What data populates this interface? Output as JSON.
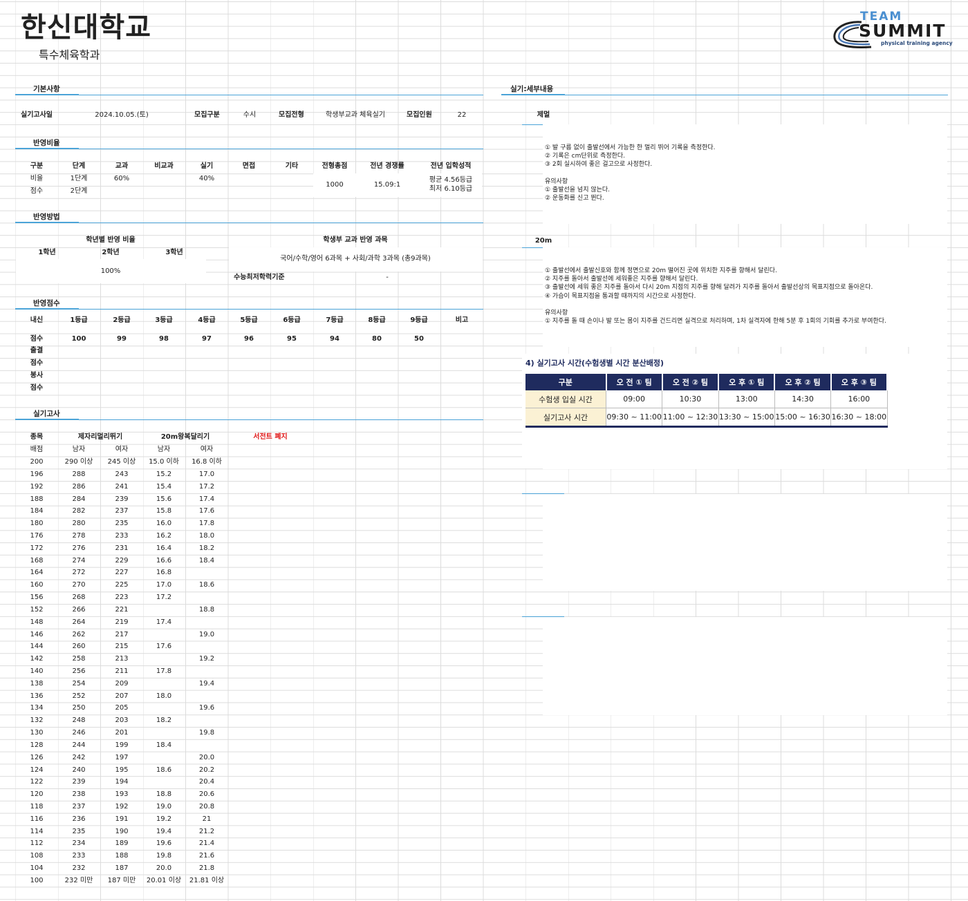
{
  "header": {
    "university": "한신대학교",
    "department": "특수체육학과",
    "logo": {
      "team": "TEAM",
      "summit": "SUMMIT",
      "tagline": "physical training agency"
    }
  },
  "basic": {
    "section_label": "기본사항",
    "exam_date_label": "실기고사일",
    "exam_date": "2024.10.05.(토)",
    "category_label": "모집구분",
    "category": "수시",
    "track_label": "모집전형",
    "track": "학생부교과 체육실기",
    "quota_label": "모집인원",
    "quota": "22"
  },
  "ratio": {
    "section_label": "반영비율",
    "headers": [
      "구분",
      "단계",
      "교과",
      "비교과",
      "실기",
      "면접",
      "기타",
      "전형총점",
      "전년 경쟁률",
      "전년 입학성적"
    ],
    "row1": {
      "label": "비율",
      "stage": "1단계",
      "subject": "60%",
      "practical": "40%"
    },
    "row2": {
      "label": "점수",
      "stage": "2단계"
    },
    "total": "1000",
    "competition": "15.09:1",
    "grade_avg": "평균 4.56등급",
    "grade_min": "최저 6.10등급"
  },
  "method": {
    "section_label": "반영방법",
    "year_ratio_label": "학년별 반영 비율",
    "years": [
      "1학년",
      "2학년",
      "3학년"
    ],
    "year_value": "100%",
    "subjects_label": "학생부 교과 반영 과목",
    "subjects": "국어/수학/영어 6과목 + 사회/과학 3과목 (총9과목)",
    "csat_label": "수능최저학력기준",
    "csat_value": "-"
  },
  "score": {
    "section_label": "반영점수",
    "headers": [
      "내신",
      "1등급",
      "2등급",
      "3등급",
      "4등급",
      "5등급",
      "6등급",
      "7등급",
      "8등급",
      "9등급",
      "비고"
    ],
    "score_label": "점수",
    "values": [
      "100",
      "99",
      "98",
      "97",
      "96",
      "95",
      "94",
      "80",
      "50"
    ],
    "rows": [
      "출결",
      "점수",
      "봉사",
      "점수"
    ]
  },
  "practical": {
    "section_label": "실기고사",
    "event_label": "종목",
    "event1": "제자리멀리뛰기",
    "event2": "20m왕복달리기",
    "note": "서전트 폐지",
    "points_label": "배점",
    "male": "남자",
    "female": "여자",
    "rows": [
      [
        "200",
        "290 이상",
        "245 이상",
        "15.0 이하",
        "16.8 이하"
      ],
      [
        "196",
        "288",
        "243",
        "15.2",
        "17.0"
      ],
      [
        "192",
        "286",
        "241",
        "15.4",
        "17.2"
      ],
      [
        "188",
        "284",
        "239",
        "15.6",
        "17.4"
      ],
      [
        "184",
        "282",
        "237",
        "15.8",
        "17.6"
      ],
      [
        "180",
        "280",
        "235",
        "16.0",
        "17.8"
      ],
      [
        "176",
        "278",
        "233",
        "16.2",
        "18.0"
      ],
      [
        "172",
        "276",
        "231",
        "16.4",
        "18.2"
      ],
      [
        "168",
        "274",
        "229",
        "16.6",
        "18.4"
      ],
      [
        "164",
        "272",
        "227",
        "16.8",
        ""
      ],
      [
        "160",
        "270",
        "225",
        "17.0",
        "18.6"
      ],
      [
        "156",
        "268",
        "223",
        "17.2",
        ""
      ],
      [
        "152",
        "266",
        "221",
        "",
        "18.8"
      ],
      [
        "148",
        "264",
        "219",
        "17.4",
        ""
      ],
      [
        "146",
        "262",
        "217",
        "",
        "19.0"
      ],
      [
        "144",
        "260",
        "215",
        "17.6",
        ""
      ],
      [
        "142",
        "258",
        "213",
        "",
        "19.2"
      ],
      [
        "140",
        "256",
        "211",
        "17.8",
        ""
      ],
      [
        "138",
        "254",
        "209",
        "",
        "19.4"
      ],
      [
        "136",
        "252",
        "207",
        "18.0",
        ""
      ],
      [
        "134",
        "250",
        "205",
        "",
        "19.6"
      ],
      [
        "132",
        "248",
        "203",
        "18.2",
        ""
      ],
      [
        "130",
        "246",
        "201",
        "",
        "19.8"
      ],
      [
        "128",
        "244",
        "199",
        "18.4",
        ""
      ],
      [
        "126",
        "242",
        "197",
        "",
        "20.0"
      ],
      [
        "124",
        "240",
        "195",
        "18.6",
        "20.2"
      ],
      [
        "122",
        "239",
        "194",
        "",
        "20.4"
      ],
      [
        "120",
        "238",
        "193",
        "18.8",
        "20.6"
      ],
      [
        "118",
        "237",
        "192",
        "19.0",
        "20.8"
      ],
      [
        "116",
        "236",
        "191",
        "19.2",
        "21"
      ],
      [
        "114",
        "235",
        "190",
        "19.4",
        "21.2"
      ],
      [
        "112",
        "234",
        "189",
        "19.6",
        "21.4"
      ],
      [
        "108",
        "233",
        "188",
        "19.8",
        "21.6"
      ],
      [
        "104",
        "232",
        "187",
        "20.0",
        "21.8"
      ],
      [
        "100",
        "232 미만",
        "187 미만",
        "20.01 이상",
        "21.81 이상"
      ]
    ]
  },
  "detail": {
    "section_label": "실기:세부내용",
    "jump": {
      "title": "제멀",
      "lines": [
        "① 발 구름 없이 출발선에서 가능한 한 멀리 뛰어 기록을 측정한다.",
        "② 기록은 cm단위로 측정한다.",
        "③ 2회 실시하여 좋은 걸고으로 사정한다.",
        "",
        "유의사항",
        "① 출발선을 넘지 않는다.",
        "② 운동화를 신고 뛴다."
      ]
    },
    "run": {
      "title": "20m",
      "lines": [
        "① 출발선에서 출발신호와 함께 정면으로 20m 떨어진 곳에 위치한 지주를 향해서 달린다.",
        "② 지주를 돌아서 출발선에 세워좋은 지주를 향해서 달린다.",
        "③ 출발선에 세워 좋은 지주를 돌아서 다시 20m 지점의 지주를 향해 달려가 지주를 돌아서 출발선상의 목표지점으로 돌아온다.",
        "④ 가슴이 목표지점을 통과할 때까지의 시간으로 사정한다.",
        "",
        "유의사항",
        "① 지주를 돌 때 손이나 발 또는 몸이 지주를 건드리면 실격으로 처리하며, 1차 실격자에 한해 5분 후 1회의 기회를 추가로 부여한다."
      ]
    }
  },
  "schedule": {
    "title": "4) 실기고사 시간(수험생별 시간 분산배정)",
    "headers": [
      "구분",
      "오 전 ① 팀",
      "오 전 ② 팀",
      "오 후 ① 팀",
      "오 후 ② 팀",
      "오 후 ③ 팀"
    ],
    "rows": [
      {
        "label": "수험생 입실 시간",
        "values": [
          "09:00",
          "10:30",
          "13:00",
          "14:30",
          "16:00"
        ]
      },
      {
        "label": "실기고사 시간",
        "values": [
          "09:30 ~ 11:00",
          "11:00 ~ 12:30",
          "13:30 ~ 15:00",
          "15:00 ~ 16:30",
          "16:30 ~ 18:00"
        ]
      }
    ],
    "colors": {
      "header": "#1f2b5e",
      "row_label": "#fbf1d4"
    }
  }
}
